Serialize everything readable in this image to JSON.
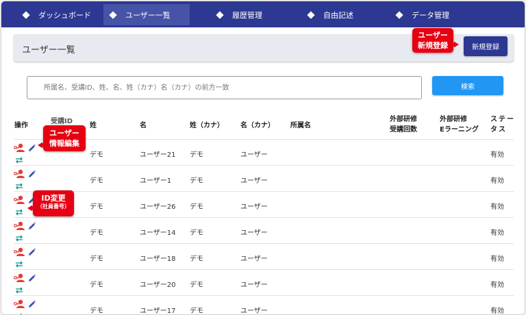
{
  "nav": [
    {
      "label": "ダッシュボード"
    },
    {
      "label": "ユーザー一覧"
    },
    {
      "label": "履歴管理"
    },
    {
      "label": "自由記述"
    },
    {
      "label": "データ管理"
    }
  ],
  "panel": {
    "title": "ユーザー一覧",
    "new_button": "新規登録"
  },
  "search": {
    "placeholder": "所属名、受講ID、姓、名、姓（カナ）名（カナ）の前方一致",
    "button": "検索"
  },
  "table": {
    "headers": {
      "ops": "操作",
      "id": "受講ID",
      "sei": "姓",
      "mei": "名",
      "sei_kana": "姓（カナ）",
      "mei_kana": "名（カナ）",
      "affiliation": "所属名",
      "ext_count": "外部研修\n受講回数",
      "ext_elearning": "外部研修\nEラーニング",
      "status": "ステー\nタス"
    },
    "rows": [
      {
        "sei": "デモ",
        "mei": "ユーザー21",
        "sei_kana": "デモ",
        "mei_kana": "ユーザー",
        "status": "有効"
      },
      {
        "sei": "デモ",
        "mei": "ユーザー1",
        "sei_kana": "デモ",
        "mei_kana": "ユーザー",
        "status": "有効"
      },
      {
        "sei": "デモ",
        "mei": "ユーザー26",
        "sei_kana": "デモ",
        "mei_kana": "ユーザー",
        "status": "有効"
      },
      {
        "sei": "デモ",
        "mei": "ユーザー14",
        "sei_kana": "デモ",
        "mei_kana": "ユーザー",
        "status": "有効"
      },
      {
        "sei": "デモ",
        "mei": "ユーザー18",
        "sei_kana": "デモ",
        "mei_kana": "ユーザー",
        "status": "有効"
      },
      {
        "sei": "デモ",
        "mei": "ユーザー20",
        "sei_kana": "デモ",
        "mei_kana": "ユーザー",
        "status": "有効"
      },
      {
        "sei": "デモ",
        "mei": "ユーザー17",
        "sei_kana": "デモ",
        "mei_kana": "ユーザー",
        "status": "有効"
      }
    ]
  },
  "callouts": {
    "new_user": "ユーザー\n新規登録",
    "edit_user": "ユーザー\n情報編集",
    "id_change": "ID変更",
    "id_change_sub": "（社員番号）"
  },
  "colors": {
    "nav": "#2c3892",
    "primary_button": "#2c3892",
    "search_button": "#2196f3",
    "callout": "#e60012",
    "user_icon": "#e53935",
    "edit_icon": "#3f51b5",
    "swap_icon": "#009688"
  },
  "icons": {
    "nav": "diamond-icon",
    "ops": [
      "user-key-icon",
      "edit-icon",
      "swap-icon"
    ]
  }
}
